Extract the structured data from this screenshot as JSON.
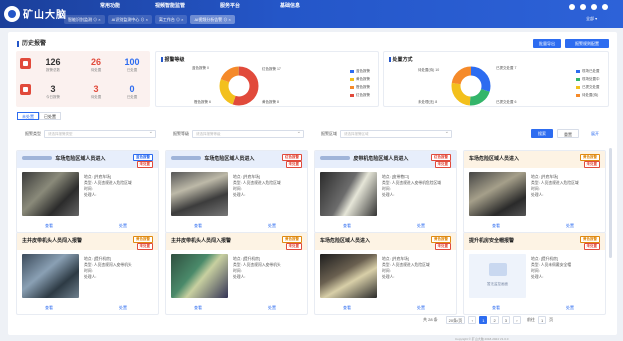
{
  "app": {
    "title": "矿山大脑"
  },
  "top_nav": [
    "常用功能",
    "视频智能监管",
    "服务平台",
    "基础信息"
  ],
  "top_tabs": [
    {
      "label": "智能识别监测 ⊙ ×",
      "active": false
    },
    {
      "label": "AI识别监测中心 ⊙ ×",
      "active": false
    },
    {
      "label": "离工作台 ⊙ ×",
      "active": false
    },
    {
      "label": "AI视频分析告警 ⊙ ×",
      "active": true
    }
  ],
  "top_right": {
    "sub": "全部 ▾"
  },
  "page": {
    "title": "历史报警",
    "btn_export": "批量导出",
    "btn_settings": "报警规则配置"
  },
  "stats": [
    {
      "value": "126",
      "label": "报警总数",
      "color": "#333"
    },
    {
      "value": "26",
      "label": "待处置",
      "color": "#e14a3b"
    },
    {
      "value": "100",
      "label": "已处置",
      "color": "#2d6cf0"
    },
    {
      "value": "3",
      "label": "今日报警",
      "color": "#333"
    },
    {
      "value": "3",
      "label": "待处置",
      "color": "#e14a3b"
    },
    {
      "value": "0",
      "label": "已处置",
      "color": "#2d6cf0"
    }
  ],
  "chart_level": {
    "title": "报警等级",
    "labels": [
      "蓝色报警 0",
      "红色报警 17",
      "黄色报警 8",
      "橙色报警 6"
    ],
    "legend": [
      "蓝色报警",
      "黄色报警",
      "橙色报警",
      "红色报警"
    ],
    "colors": [
      "#2d6cf0",
      "#f3c01c",
      "#f58a2a",
      "#e14a3b"
    ]
  },
  "chart_mode": {
    "title": "处置方式",
    "labels": [
      "待处置(待) 10",
      "已提交处置 7",
      "未处理(无) 8",
      "已提交处置 6"
    ],
    "legend": [
      "现场已处置",
      "现场处置中",
      "已提交处置",
      "待处置(待)"
    ],
    "colors": [
      "#2d6cf0",
      "#34b56a",
      "#f3c01c",
      "#f58a2a"
    ]
  },
  "tabs": [
    {
      "label": "未处置",
      "active": true
    },
    {
      "label": "已处置",
      "active": false
    }
  ],
  "filters": [
    {
      "label": "报警类型",
      "placeholder": "请选择报警类型"
    },
    {
      "label": "报警等级",
      "placeholder": "请选择报警等级"
    },
    {
      "label": "报警区域",
      "placeholder": "请选择报警区域"
    }
  ],
  "buttons": {
    "search": "搜索",
    "reset": "重置",
    "expand": "展开"
  },
  "cards": [
    {
      "title": "车场危险区域人员进入",
      "badge1": "蓝色报警",
      "badge2": "未处置",
      "tone": "blue",
      "loc": "[井底车场]",
      "type": "人员违规进入危险区域",
      "time": "",
      "handler": "",
      "act1": "查看",
      "act2": "处置"
    },
    {
      "title": "车场危险区域人员进入",
      "badge1": "红色报警",
      "badge2": "未处置",
      "tone": "blue",
      "loc": "[井底车场]",
      "type": "人员违规进入危险区域",
      "time": "",
      "handler": "",
      "act1": "查看",
      "act2": "处置"
    },
    {
      "title": "皮带机危险区域人员进入",
      "badge1": "红色报警",
      "badge2": "未处置",
      "tone": "blue",
      "loc": "[皮带巷口]",
      "type": "人员违规进入皮带机危险区域",
      "time": "",
      "handler": "",
      "act1": "查看",
      "act2": "处置"
    },
    {
      "title": "车场危险区域人员进入",
      "badge1": "黄色报警",
      "badge2": "未处置",
      "tone": "orange",
      "loc": "[井底车场]",
      "type": "人员违规进入危险区域",
      "time": "",
      "handler": "",
      "act1": "查看",
      "act2": "处置"
    },
    {
      "title": "主井皮带机头人员闯入报警",
      "badge1": "黄色报警",
      "badge2": "未处置",
      "tone": "orange",
      "loc": "[提升机房]",
      "type": "人员违规闯入皮带机头",
      "time": "",
      "handler": "",
      "act1": "查看",
      "act2": "处置"
    },
    {
      "title": "主井皮带机头人员闯入报警",
      "badge1": "黄色报警",
      "badge2": "未处置",
      "tone": "orange",
      "loc": "[提升机房]",
      "type": "人员违规闯入皮带机头",
      "time": "",
      "handler": "",
      "act1": "查看",
      "act2": "处置"
    },
    {
      "title": "车场危险区域人员进入",
      "badge1": "黄色报警",
      "badge2": "未处置",
      "tone": "orange",
      "loc": "[井底车场]",
      "type": "人员违规进入危险区域",
      "time": "",
      "handler": "",
      "act1": "查看",
      "act2": "处置"
    },
    {
      "title": "提升机房安全帽报警",
      "badge1": "黄色报警",
      "badge2": "未处置",
      "tone": "orange",
      "loc": "[提升机房]",
      "type": "人员未佩戴安全帽",
      "time": "",
      "handler": "",
      "act1": "查看",
      "act2": "处置",
      "placeholder_img": "暂无监控画面"
    }
  ],
  "field_labels": {
    "loc": "地点:",
    "type": "类型:",
    "time": "时间:",
    "handler": "处理人:"
  },
  "pager": {
    "total": "共 28 条",
    "size": "20条/页",
    "pages": [
      "1",
      "2",
      "3"
    ],
    "goto": "前往",
    "page_input": "1",
    "unit": "页"
  },
  "footer": "Copyright © 矿山大脑 2018-2024 V1.0.0"
}
